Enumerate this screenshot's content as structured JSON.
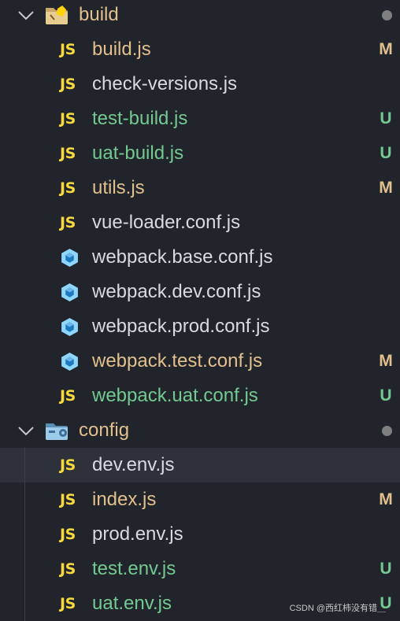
{
  "colors": {
    "background": "#21252b",
    "selected_row": "#2c313a",
    "default_text": "#d7dae0",
    "modified": "#e2c08d",
    "untracked": "#73c991",
    "js_icon": "#f5d93d",
    "webpack_icon": "#8ed6fb"
  },
  "folders": [
    {
      "label": "build",
      "icon": "folder-build-icon",
      "files": [
        {
          "icon": "js",
          "icon_text": "JS",
          "label": "build.js",
          "status": "M"
        },
        {
          "icon": "js",
          "icon_text": "JS",
          "label": "check-versions.js",
          "status": ""
        },
        {
          "icon": "js",
          "icon_text": "JS",
          "label": "test-build.js",
          "status": "U"
        },
        {
          "icon": "js",
          "icon_text": "JS",
          "label": "uat-build.js",
          "status": "U"
        },
        {
          "icon": "js",
          "icon_text": "JS",
          "label": "utils.js",
          "status": "M"
        },
        {
          "icon": "js",
          "icon_text": "JS",
          "label": "vue-loader.conf.js",
          "status": ""
        },
        {
          "icon": "webpack",
          "icon_text": "",
          "label": "webpack.base.conf.js",
          "status": ""
        },
        {
          "icon": "webpack",
          "icon_text": "",
          "label": "webpack.dev.conf.js",
          "status": ""
        },
        {
          "icon": "webpack",
          "icon_text": "",
          "label": "webpack.prod.conf.js",
          "status": ""
        },
        {
          "icon": "webpack",
          "icon_text": "",
          "label": "webpack.test.conf.js",
          "status": "M"
        },
        {
          "icon": "js",
          "icon_text": "JS",
          "label": "webpack.uat.conf.js",
          "status": "U"
        }
      ]
    },
    {
      "label": "config",
      "icon": "folder-config-icon",
      "files": [
        {
          "icon": "js",
          "icon_text": "JS",
          "label": "dev.env.js",
          "status": "",
          "selected": true
        },
        {
          "icon": "js",
          "icon_text": "JS",
          "label": "index.js",
          "status": "M"
        },
        {
          "icon": "js",
          "icon_text": "JS",
          "label": "prod.env.js",
          "status": ""
        },
        {
          "icon": "js",
          "icon_text": "JS",
          "label": "test.env.js",
          "status": "U"
        },
        {
          "icon": "js",
          "icon_text": "JS",
          "label": "uat.env.js",
          "status": "U"
        }
      ]
    }
  ],
  "watermark": "CSDN @西红柿没有错＿"
}
